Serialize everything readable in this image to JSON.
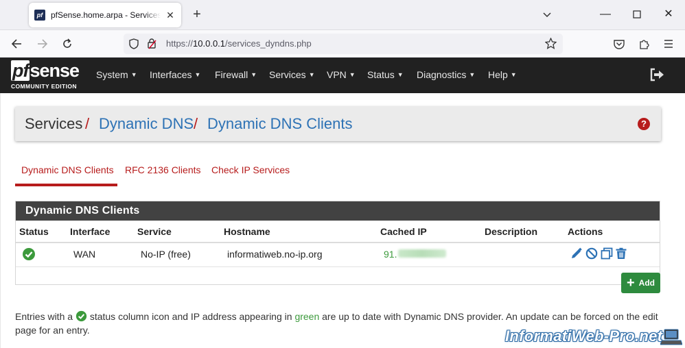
{
  "browser": {
    "tab_title": "pfSense.home.arpa - Services: Dynamic DNS: Dynamic DNS Clients",
    "tab_favicon_text": "pf",
    "url_prefix": "https://",
    "url_host": "10.0.0.1",
    "url_path": "/services_dyndns.php"
  },
  "pfsense": {
    "logo_word": "sense",
    "logo_pf": "pf",
    "logo_sub": "COMMUNITY EDITION",
    "menu": [
      "System",
      "Interfaces",
      "Firewall",
      "Services",
      "VPN",
      "Status",
      "Diagnostics",
      "Help"
    ]
  },
  "breadcrumb": {
    "root": "Services",
    "sep": "/",
    "level1": "Dynamic DNS",
    "level2": "Dynamic DNS Clients"
  },
  "help_icon_text": "?",
  "subtabs": [
    "Dynamic DNS Clients",
    "RFC 2136 Clients",
    "Check IP Services"
  ],
  "panel": {
    "title": "Dynamic DNS Clients",
    "columns": [
      "Status",
      "Interface",
      "Service",
      "Hostname",
      "Cached IP",
      "Description",
      "Actions"
    ],
    "rows": [
      {
        "status": "ok",
        "interface": "WAN",
        "service": "No-IP (free)",
        "hostname": "informatiweb.no-ip.org",
        "cached_ip": "91.",
        "description": ""
      }
    ],
    "actions": [
      "edit-icon",
      "disable-icon",
      "copy-icon",
      "delete-icon"
    ]
  },
  "add_button_label": "Add",
  "info": {
    "part1": "Entries with a",
    "part2": "status column icon and IP address appearing in",
    "green_word": "green",
    "part3": "are up to date with Dynamic DNS provider. An update can be forced on the edit page for an entry."
  },
  "watermark": "InformatiWeb-Pro.net",
  "colors": {
    "pfsense_red": "#b71c1c",
    "link_blue": "#2d72b5",
    "ok_green": "#3c9a3c",
    "add_green": "#2e8b3e",
    "topbar": "#212121",
    "panel_heading": "#424242"
  }
}
